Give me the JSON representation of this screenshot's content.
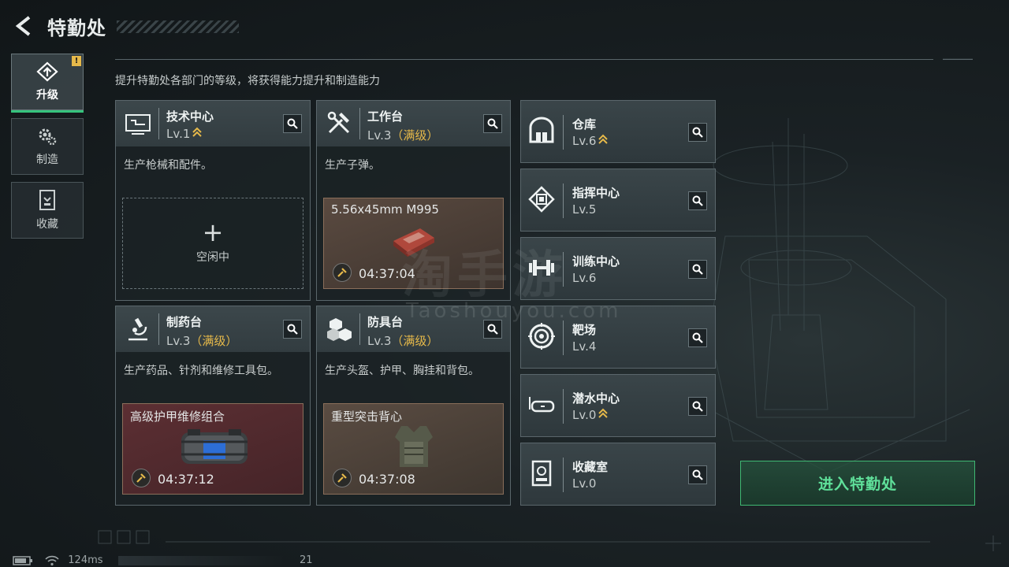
{
  "header": {
    "title": "特勤处"
  },
  "subtitle": "提升特勤处各部门的等级，将获得能力提升和制造能力",
  "nav": [
    {
      "label": "升级",
      "icon": "upgrade-icon",
      "active": true
    },
    {
      "label": "制造",
      "icon": "gears-icon",
      "active": false
    },
    {
      "label": "收藏",
      "icon": "collection-icon",
      "active": false
    }
  ],
  "departments": {
    "tech": {
      "name": "技术中心",
      "level": "Lv.1",
      "desc": "生产枪械和配件。",
      "idle": "空闲中",
      "icon": "computer-icon"
    },
    "workbench": {
      "name": "工作台",
      "level": "Lv.3",
      "max": "（满级）",
      "desc": "生产子弹。",
      "item": "5.56x45mm M995",
      "time": "04:37:04",
      "icon": "tools-icon"
    },
    "pharmacy": {
      "name": "制药台",
      "level": "Lv.3",
      "max": "（满级）",
      "desc": "生产药品、针剂和维修工具包。",
      "item": "高级护甲维修组合",
      "time": "04:37:12",
      "icon": "microscope-icon"
    },
    "armor": {
      "name": "防具台",
      "level": "Lv.3",
      "max": "（满级）",
      "desc": "生产头盔、护甲、胸挂和背包。",
      "item": "重型突击背心",
      "time": "04:37:08",
      "icon": "cubes-icon"
    }
  },
  "side_departments": [
    {
      "name": "仓库",
      "level": "Lv.6",
      "upgradable": true,
      "icon": "warehouse-icon"
    },
    {
      "name": "指挥中心",
      "level": "Lv.5",
      "upgradable": false,
      "icon": "chip-icon"
    },
    {
      "name": "训练中心",
      "level": "Lv.6",
      "upgradable": false,
      "icon": "dumbbell-icon"
    },
    {
      "name": "靶场",
      "level": "Lv.4",
      "upgradable": false,
      "icon": "target-icon"
    },
    {
      "name": "潜水中心",
      "level": "Lv.0",
      "upgradable": true,
      "icon": "goggles-icon"
    },
    {
      "name": "收藏室",
      "level": "Lv.0",
      "upgradable": false,
      "icon": "vault-icon"
    }
  ],
  "enter_button": "进入特勤处",
  "alert_badge": "!",
  "watermark": {
    "main": "淘手游",
    "sub": "Taoshouyou.com"
  },
  "status_bar": {
    "ping": "124ms",
    "fps": "21"
  },
  "colors": {
    "accent_green": "#35c37c",
    "max_level": "#e6b94a",
    "upgrade_chevron": "#e6b94a"
  }
}
